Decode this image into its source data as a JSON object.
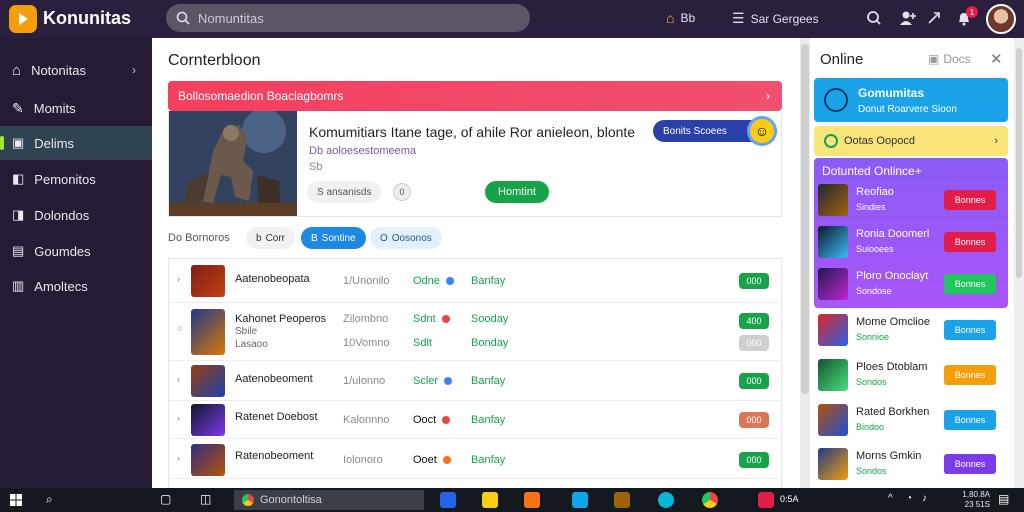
{
  "app": {
    "logo_text": "Konunitas"
  },
  "search": {
    "placeholder": "Nomuntitas"
  },
  "topbar": {
    "home_label": "Bb",
    "menu_label": "Sar Gergees",
    "notification_count": "1"
  },
  "sidebar": {
    "items": [
      {
        "label": "Notonitas",
        "icon": "home-icon",
        "has_chevron": true
      },
      {
        "label": "Momits",
        "icon": "pen-icon"
      },
      {
        "label": "Delims",
        "icon": "folder-icon",
        "active": true
      },
      {
        "label": "Pemonitos",
        "icon": "bag-icon"
      },
      {
        "label": "Dolondos",
        "icon": "bag-icon"
      },
      {
        "label": "Goumdes",
        "icon": "grid-icon"
      },
      {
        "label": "Amoltecs",
        "icon": "doc-icon"
      }
    ]
  },
  "main": {
    "title": "Cornterbloon",
    "banner": "Bollosomaedion Boaclagbomrs",
    "feature": {
      "title": "Komumitiars Itane tage, of ahile Ror anieleon, blonte",
      "subtitle": "Db aoloesestomeema",
      "meta": "Sb",
      "pill_grey": "S ansanisds",
      "pill_circle": "0",
      "green_button": "Homtint",
      "blue_pill": "Bonits Scoees"
    },
    "filter": {
      "label": "Do Bornoros",
      "chips": [
        {
          "label": "Corr",
          "prefix": "b"
        },
        {
          "label": "Sontine",
          "prefix": "B"
        },
        {
          "label": "Oosonos",
          "prefix": "O"
        }
      ]
    },
    "rows": [
      {
        "num": "›",
        "name": "Aatenobeopata",
        "date": "1/Unonilo",
        "c3": "Odne",
        "c3_color": "#16a34a",
        "dot": "#3b82f6",
        "c4": "Banfay",
        "stat": "000",
        "stat_color": "#16a34a"
      },
      {
        "num": "○",
        "name": "Kahonet Peoperos",
        "sub1": "Sbile",
        "sub2": "Lasaoo",
        "date": "Zilombno",
        "date2": "10Vomno",
        "c3": "Sdnt",
        "c3b": "Sdlt",
        "c3_color": "#16a34a",
        "dot": "#ef4444",
        "c4": "Sooday",
        "c4b": "Bonday",
        "stat": "400",
        "stat2": "000",
        "stat_color": "#16a34a",
        "stat2_color": "#cfcfcf"
      },
      {
        "num": "›",
        "name": "Aatenobeoment",
        "date": "1/ulonno",
        "c3": "Scler",
        "c3_color": "#16a34a",
        "dot": "#3b82f6",
        "c4": "Banfay",
        "stat": "000",
        "stat_color": "#16a34a"
      },
      {
        "num": "›",
        "name": "Ratenet Doebost",
        "date": "Kalonnno",
        "c3": "Ooct",
        "c3_color": "#111",
        "dot": "#ef4444",
        "c4": "Banfay",
        "stat": "000",
        "stat_color": "#d97757"
      },
      {
        "num": "›",
        "name": "Ratenobeoment",
        "date": "Iolonoro",
        "c3": "Ooet",
        "c3_color": "#111",
        "dot": "#f97316",
        "c4": "Banfay",
        "stat": "000",
        "stat_color": "#16a34a"
      }
    ]
  },
  "right_panel": {
    "title": "Online",
    "docs_label": "Docs",
    "blue_card": {
      "title": "Gomumitas",
      "subtitle": "Donut Roarvere Sioon"
    },
    "yellow_card": "Ootas Oopocd",
    "purple_title": "Dotunted Onlince+",
    "items": [
      {
        "name": "Reofiao",
        "sub": "Sindies",
        "btn": "Bonnes",
        "btn_color": "#e11d48",
        "text_color": "#fff"
      },
      {
        "name": "Ronia Doomerl",
        "sub": "Suiooees",
        "btn": "Bonnes",
        "btn_color": "#e11d48",
        "text_color": "#fff"
      },
      {
        "name": "Ploro Onoclayt",
        "sub": "Sondose",
        "btn": "Bonnes",
        "btn_color": "#22c55e",
        "text_color": "#fff"
      },
      {
        "name": "Mome Omclioe",
        "sub": "Sonnioe",
        "btn": "Bonnes",
        "btn_color": "#1aa3e8",
        "text_color": "#222"
      },
      {
        "name": "Ploes Dtoblam",
        "sub": "Sondos",
        "btn": "Bonnes",
        "btn_color": "#f59e0b",
        "text_color": "#222"
      },
      {
        "name": "Rated Borkhen",
        "sub": "Bindoo",
        "btn": "Bonnes",
        "btn_color": "#1aa3e8",
        "text_color": "#222"
      },
      {
        "name": "Morns Gmkin",
        "sub": "Sondos",
        "btn": "Bonnes",
        "btn_color": "#7c3aed",
        "text_color": "#222"
      }
    ]
  },
  "taskbar": {
    "search_label": "Gonontoltisa",
    "tray_label": "0:5A",
    "clock_time": "1,80.8A",
    "clock_date": "23 51S"
  }
}
